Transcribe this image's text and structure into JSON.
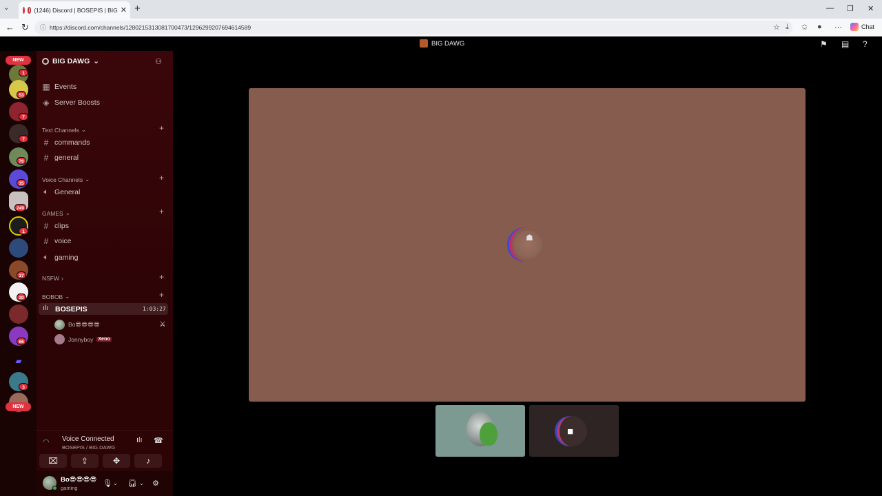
{
  "browser": {
    "tab_title": "(1246) Discord | BOSEPIS | BIG",
    "tab_close": "✕",
    "new_tab": "+",
    "url": "https://discord.com/channels/1280215313081700473/1296299207694614589",
    "chat_label": "Chat"
  },
  "topbar": {
    "title": "BIG DAWG"
  },
  "servers": {
    "badges": [
      "1",
      "53",
      "7",
      "7",
      "76",
      "35",
      "249",
      "1",
      "37",
      "20",
      "66",
      "3"
    ],
    "new_labels": [
      "NEW",
      "NEW"
    ]
  },
  "guild": {
    "name": "BIG DAWG",
    "items": [
      {
        "label": "Events",
        "icon": "calendar-icon"
      },
      {
        "label": "Server Boosts",
        "icon": "boost-icon"
      }
    ],
    "categories": {
      "text": "Text Channels",
      "voice": "Voice Channels",
      "games": "GAMES",
      "nsfw": "NSFW",
      "bobob": "BOBOB"
    },
    "channels": {
      "commands": "commands",
      "general_text": "general",
      "general_voice": "General",
      "clips": "clips",
      "voice": "voice",
      "gaming": "gaming"
    },
    "active_voice": {
      "name": "BOSEPIS",
      "time": "1:03:27",
      "users": [
        {
          "name": "Bo😎😎😎😎"
        },
        {
          "name": "Jonnyboy",
          "tag": "Xeno"
        }
      ]
    }
  },
  "voice_panel": {
    "status": "Voice Connected",
    "location": "BOSEPIS / BIG DAWG"
  },
  "user_panel": {
    "name": "Bo😎😎😎😎",
    "status": "gaming"
  },
  "colors": {
    "accent_red": "#e0323f",
    "voice_green": "#4cc46a",
    "stage_bg": "#855c4e"
  }
}
